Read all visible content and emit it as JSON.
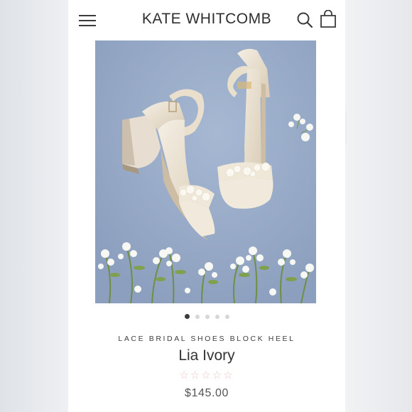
{
  "header": {
    "brand": "KATE WHITCOMB",
    "menu_icon": "hamburger-menu-icon",
    "search_icon": "search-icon",
    "cart_icon": "shopping-bag-icon"
  },
  "product": {
    "image": {
      "description_icon": "product-photo",
      "background_color": "#97aac6"
    },
    "carousel": {
      "total_slides": 5,
      "active_index": 1
    },
    "category": "LACE BRIDAL SHOES BLOCK HEEL",
    "name": "Lia Ivory",
    "rating": {
      "stars_display": "☆☆☆☆☆",
      "value": 0,
      "max": 5,
      "star_color": "#efc6c6"
    },
    "price": "$145.00"
  }
}
